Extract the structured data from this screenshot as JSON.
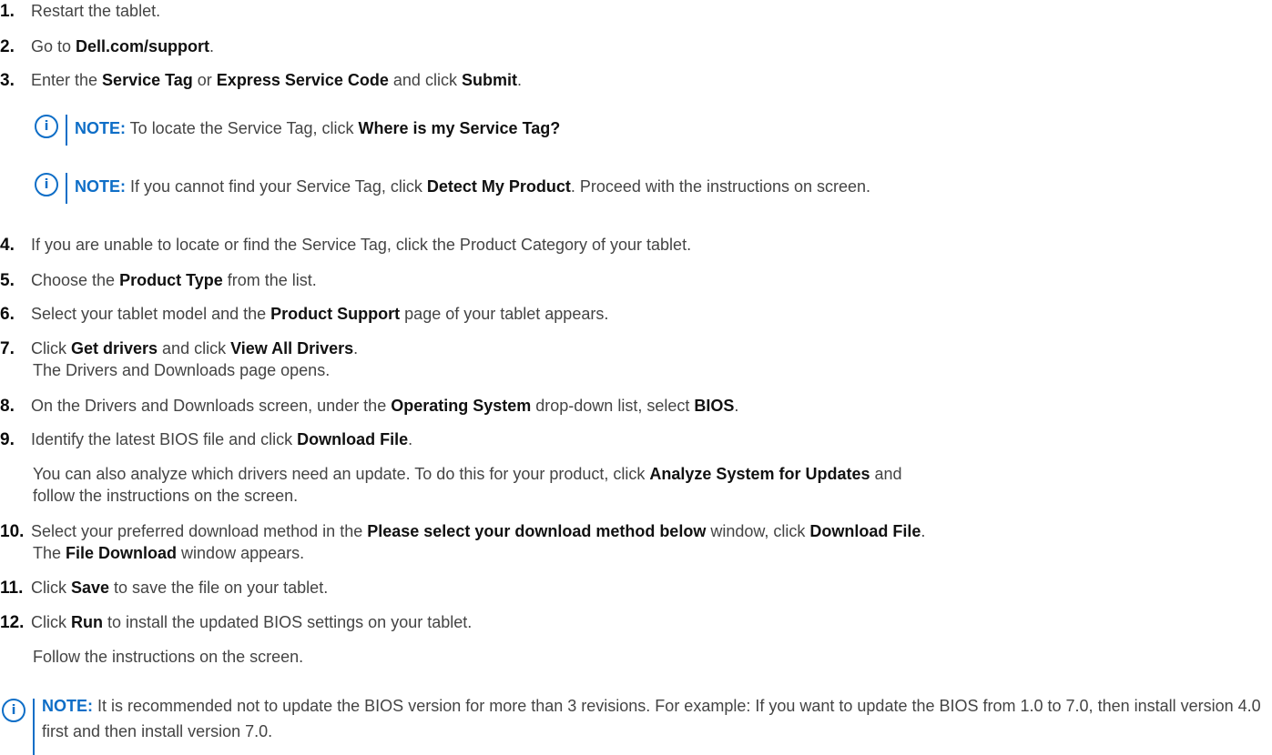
{
  "steps": [
    {
      "num": "1.",
      "parts": [
        {
          "t": "Restart the tablet."
        }
      ]
    },
    {
      "num": "2.",
      "parts": [
        {
          "t": "Go to "
        },
        {
          "t": "Dell.com/support",
          "b": true
        },
        {
          "t": "."
        }
      ]
    },
    {
      "num": "3.",
      "parts": [
        {
          "t": "Enter the "
        },
        {
          "t": "Service Tag",
          "b": true
        },
        {
          "t": " or "
        },
        {
          "t": "Express Service Code",
          "b": true
        },
        {
          "t": " and click "
        },
        {
          "t": "Submit",
          "b": true
        },
        {
          "t": "."
        }
      ]
    },
    {
      "num": "4.",
      "parts": [
        {
          "t": "If you are unable to locate or find the Service Tag, click the Product Category of your tablet."
        }
      ]
    },
    {
      "num": "5.",
      "parts": [
        {
          "t": "Choose the "
        },
        {
          "t": "Product Type",
          "b": true
        },
        {
          "t": " from the list."
        }
      ]
    },
    {
      "num": "6.",
      "parts": [
        {
          "t": "Select your tablet model and the "
        },
        {
          "t": "Product Support",
          "b": true
        },
        {
          "t": " page of your tablet appears."
        }
      ]
    },
    {
      "num": "7.",
      "parts": [
        {
          "t": "Click "
        },
        {
          "t": "Get drivers",
          "b": true
        },
        {
          "t": " and click "
        },
        {
          "t": "View All Drivers",
          "b": true
        },
        {
          "t": "."
        }
      ]
    },
    {
      "num": "8.",
      "parts": [
        {
          "t": "On the Drivers and Downloads screen, under the "
        },
        {
          "t": "Operating System",
          "b": true
        },
        {
          "t": " drop-down list, select "
        },
        {
          "t": "BIOS",
          "b": true
        },
        {
          "t": "."
        }
      ]
    },
    {
      "num": "9.",
      "parts": [
        {
          "t": "Identify the latest BIOS file and click "
        },
        {
          "t": "Download File",
          "b": true
        },
        {
          "t": "."
        }
      ]
    },
    {
      "num": "10.",
      "parts": [
        {
          "t": "Select your preferred download method in the "
        },
        {
          "t": "Please select your download method below",
          "b": true
        },
        {
          "t": " window, click "
        },
        {
          "t": "Download File",
          "b": true
        },
        {
          "t": "."
        }
      ]
    },
    {
      "num": "11.",
      "parts": [
        {
          "t": "Click "
        },
        {
          "t": "Save",
          "b": true
        },
        {
          "t": " to save the file on your tablet."
        }
      ]
    },
    {
      "num": "12.",
      "parts": [
        {
          "t": "Click "
        },
        {
          "t": "Run",
          "b": true
        },
        {
          "t": " to install the updated BIOS settings on your tablet."
        }
      ]
    }
  ],
  "sublines": {
    "s7": [
      {
        "t": "The Drivers and Downloads page opens."
      }
    ],
    "s9a": [
      {
        "t": "You can also analyze which drivers need an update. To do this for your product, click "
      },
      {
        "t": "Analyze System for Updates",
        "b": true
      },
      {
        "t": " and"
      }
    ],
    "s9b": [
      {
        "t": "follow the instructions on the screen."
      }
    ],
    "s10": [
      {
        "t": "The "
      },
      {
        "t": "File Download",
        "b": true
      },
      {
        "t": " window appears."
      }
    ],
    "s12": [
      {
        "t": "Follow the instructions on the screen."
      }
    ]
  },
  "notes": [
    {
      "label": "NOTE:",
      "parts": [
        {
          "t": " To locate the Service Tag, click "
        },
        {
          "t": "Where is my Service Tag?",
          "b": true
        }
      ]
    },
    {
      "label": "NOTE:",
      "parts": [
        {
          "t": " If you cannot find your Service Tag, click "
        },
        {
          "t": "Detect My Product",
          "b": true
        },
        {
          "t": ". Proceed with the instructions on screen."
        }
      ]
    },
    {
      "label": "NOTE:",
      "parts": [
        {
          "t": " It is recommended not to update the BIOS version for more than 3 revisions. For example: If you want to update the BIOS from 1.0 to 7.0, then install version 4.0 first and then install version 7.0."
        }
      ]
    }
  ],
  "icons": {
    "note": "info-icon",
    "glyph": "i"
  },
  "colors": {
    "accent": "#0e6ec7",
    "text": "#444444",
    "bold": "#111111"
  }
}
